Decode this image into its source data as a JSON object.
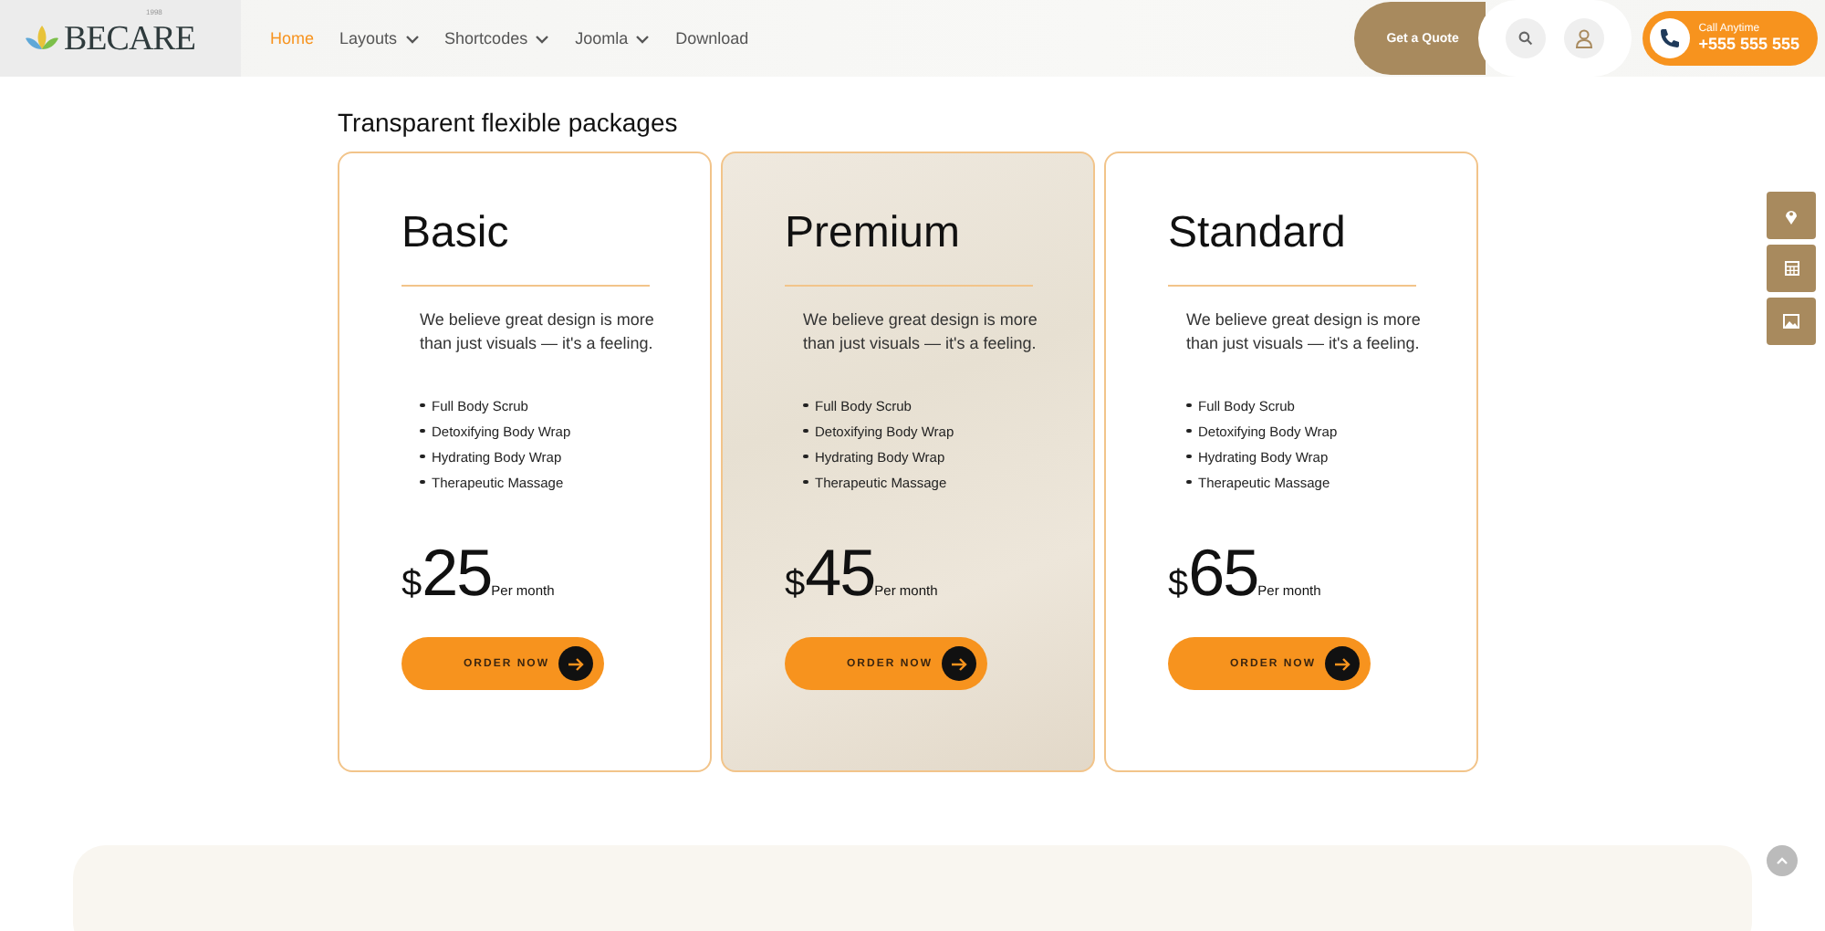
{
  "header": {
    "logo": "BECARE",
    "logo_tag": "1998",
    "nav": [
      {
        "label": "Home",
        "selected": true,
        "dropdown": false
      },
      {
        "label": "Layouts",
        "selected": false,
        "dropdown": true
      },
      {
        "label": "Shortcodes",
        "selected": false,
        "dropdown": true
      },
      {
        "label": "Joomla",
        "selected": false,
        "dropdown": true
      },
      {
        "label": "Download",
        "selected": false,
        "dropdown": false
      }
    ],
    "quote_button": "Get a Quote",
    "call": {
      "label": "Call Anytime",
      "phone": "+555 555 555"
    }
  },
  "section_title": "Transparent flexible packages",
  "plans": [
    {
      "name": "Basic",
      "featured": false,
      "description": "We believe great design is more than just visuals — it's a feeling.",
      "features": [
        "Full Body Scrub",
        "Detoxifying Body Wrap",
        "Hydrating Body Wrap",
        "Therapeutic Massage"
      ],
      "currency": "$",
      "price": "25",
      "period": "Per month",
      "button": "ORDER NOW"
    },
    {
      "name": "Premium",
      "featured": true,
      "description": "We believe great design is more than just visuals — it's a feeling.",
      "features": [
        "Full Body Scrub",
        "Detoxifying Body Wrap",
        "Hydrating Body Wrap",
        "Therapeutic Massage"
      ],
      "currency": "$",
      "price": "45",
      "period": "Per month",
      "button": "ORDER NOW"
    },
    {
      "name": "Standard",
      "featured": false,
      "description": "We believe great design is more than just visuals — it's a feeling.",
      "features": [
        "Full Body Scrub",
        "Detoxifying Body Wrap",
        "Hydrating Body Wrap",
        "Therapeutic Massage"
      ],
      "currency": "$",
      "price": "65",
      "period": "Per month",
      "button": "ORDER NOW"
    }
  ],
  "side_tools": [
    {
      "kind": "location"
    },
    {
      "kind": "calendar"
    },
    {
      "kind": "image"
    }
  ]
}
